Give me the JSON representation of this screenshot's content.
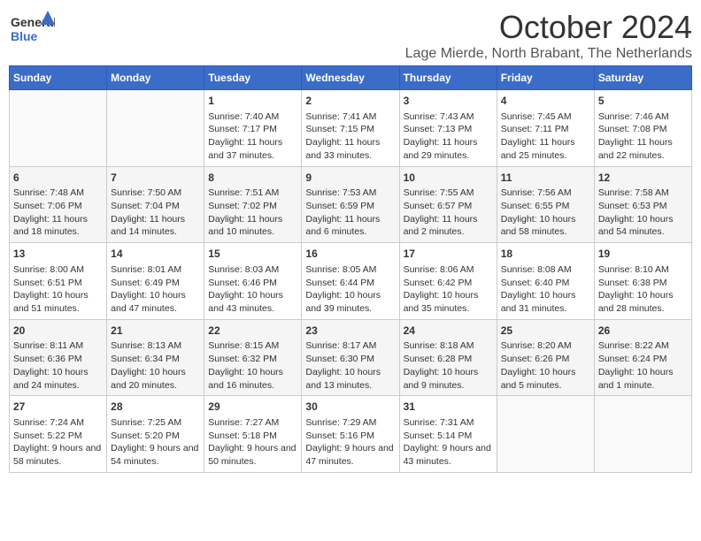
{
  "header": {
    "logo_text_general": "General",
    "logo_text_blue": "Blue",
    "month_title": "October 2024",
    "location": "Lage Mierde, North Brabant, The Netherlands"
  },
  "days_of_week": [
    "Sunday",
    "Monday",
    "Tuesday",
    "Wednesday",
    "Thursday",
    "Friday",
    "Saturday"
  ],
  "weeks": [
    [
      {
        "day": "",
        "content": ""
      },
      {
        "day": "",
        "content": ""
      },
      {
        "day": "1",
        "content": "Sunrise: 7:40 AM\nSunset: 7:17 PM\nDaylight: 11 hours and 37 minutes."
      },
      {
        "day": "2",
        "content": "Sunrise: 7:41 AM\nSunset: 7:15 PM\nDaylight: 11 hours and 33 minutes."
      },
      {
        "day": "3",
        "content": "Sunrise: 7:43 AM\nSunset: 7:13 PM\nDaylight: 11 hours and 29 minutes."
      },
      {
        "day": "4",
        "content": "Sunrise: 7:45 AM\nSunset: 7:11 PM\nDaylight: 11 hours and 25 minutes."
      },
      {
        "day": "5",
        "content": "Sunrise: 7:46 AM\nSunset: 7:08 PM\nDaylight: 11 hours and 22 minutes."
      }
    ],
    [
      {
        "day": "6",
        "content": "Sunrise: 7:48 AM\nSunset: 7:06 PM\nDaylight: 11 hours and 18 minutes."
      },
      {
        "day": "7",
        "content": "Sunrise: 7:50 AM\nSunset: 7:04 PM\nDaylight: 11 hours and 14 minutes."
      },
      {
        "day": "8",
        "content": "Sunrise: 7:51 AM\nSunset: 7:02 PM\nDaylight: 11 hours and 10 minutes."
      },
      {
        "day": "9",
        "content": "Sunrise: 7:53 AM\nSunset: 6:59 PM\nDaylight: 11 hours and 6 minutes."
      },
      {
        "day": "10",
        "content": "Sunrise: 7:55 AM\nSunset: 6:57 PM\nDaylight: 11 hours and 2 minutes."
      },
      {
        "day": "11",
        "content": "Sunrise: 7:56 AM\nSunset: 6:55 PM\nDaylight: 10 hours and 58 minutes."
      },
      {
        "day": "12",
        "content": "Sunrise: 7:58 AM\nSunset: 6:53 PM\nDaylight: 10 hours and 54 minutes."
      }
    ],
    [
      {
        "day": "13",
        "content": "Sunrise: 8:00 AM\nSunset: 6:51 PM\nDaylight: 10 hours and 51 minutes."
      },
      {
        "day": "14",
        "content": "Sunrise: 8:01 AM\nSunset: 6:49 PM\nDaylight: 10 hours and 47 minutes."
      },
      {
        "day": "15",
        "content": "Sunrise: 8:03 AM\nSunset: 6:46 PM\nDaylight: 10 hours and 43 minutes."
      },
      {
        "day": "16",
        "content": "Sunrise: 8:05 AM\nSunset: 6:44 PM\nDaylight: 10 hours and 39 minutes."
      },
      {
        "day": "17",
        "content": "Sunrise: 8:06 AM\nSunset: 6:42 PM\nDaylight: 10 hours and 35 minutes."
      },
      {
        "day": "18",
        "content": "Sunrise: 8:08 AM\nSunset: 6:40 PM\nDaylight: 10 hours and 31 minutes."
      },
      {
        "day": "19",
        "content": "Sunrise: 8:10 AM\nSunset: 6:38 PM\nDaylight: 10 hours and 28 minutes."
      }
    ],
    [
      {
        "day": "20",
        "content": "Sunrise: 8:11 AM\nSunset: 6:36 PM\nDaylight: 10 hours and 24 minutes."
      },
      {
        "day": "21",
        "content": "Sunrise: 8:13 AM\nSunset: 6:34 PM\nDaylight: 10 hours and 20 minutes."
      },
      {
        "day": "22",
        "content": "Sunrise: 8:15 AM\nSunset: 6:32 PM\nDaylight: 10 hours and 16 minutes."
      },
      {
        "day": "23",
        "content": "Sunrise: 8:17 AM\nSunset: 6:30 PM\nDaylight: 10 hours and 13 minutes."
      },
      {
        "day": "24",
        "content": "Sunrise: 8:18 AM\nSunset: 6:28 PM\nDaylight: 10 hours and 9 minutes."
      },
      {
        "day": "25",
        "content": "Sunrise: 8:20 AM\nSunset: 6:26 PM\nDaylight: 10 hours and 5 minutes."
      },
      {
        "day": "26",
        "content": "Sunrise: 8:22 AM\nSunset: 6:24 PM\nDaylight: 10 hours and 1 minute."
      }
    ],
    [
      {
        "day": "27",
        "content": "Sunrise: 7:24 AM\nSunset: 5:22 PM\nDaylight: 9 hours and 58 minutes."
      },
      {
        "day": "28",
        "content": "Sunrise: 7:25 AM\nSunset: 5:20 PM\nDaylight: 9 hours and 54 minutes."
      },
      {
        "day": "29",
        "content": "Sunrise: 7:27 AM\nSunset: 5:18 PM\nDaylight: 9 hours and 50 minutes."
      },
      {
        "day": "30",
        "content": "Sunrise: 7:29 AM\nSunset: 5:16 PM\nDaylight: 9 hours and 47 minutes."
      },
      {
        "day": "31",
        "content": "Sunrise: 7:31 AM\nSunset: 5:14 PM\nDaylight: 9 hours and 43 minutes."
      },
      {
        "day": "",
        "content": ""
      },
      {
        "day": "",
        "content": ""
      }
    ]
  ]
}
